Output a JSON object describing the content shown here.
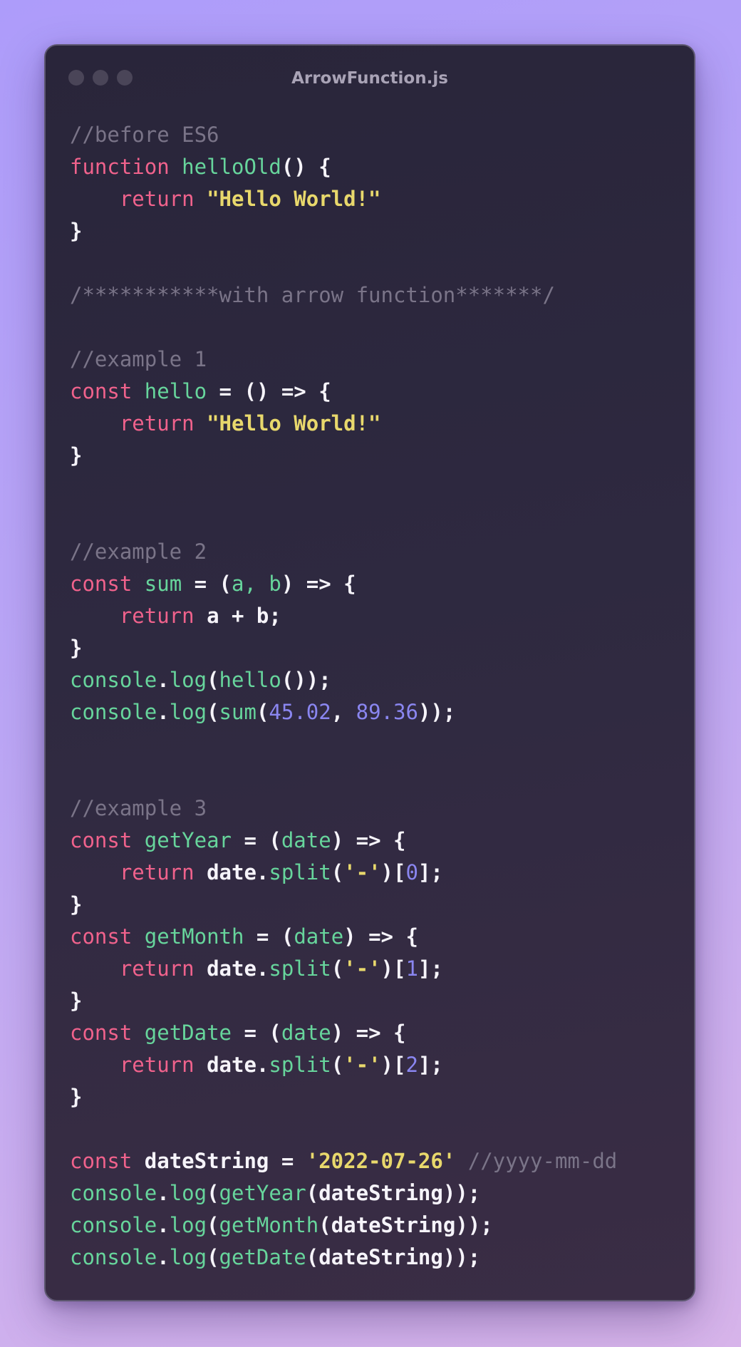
{
  "window": {
    "title": "ArrowFunction.js"
  },
  "colors": {
    "keyword": "#f0628c",
    "function": "#67d59c",
    "string": "#e8d86c",
    "comment": "#7a7488",
    "number": "#8a86f0",
    "plain": "#f6f4fa"
  },
  "code": {
    "lines": [
      [
        [
          "cmt",
          "//before ES6"
        ]
      ],
      [
        [
          "kw",
          "function"
        ],
        [
          "id",
          " "
        ],
        [
          "fn",
          "helloOld"
        ],
        [
          "punc",
          "() {"
        ]
      ],
      [
        [
          "id",
          "    "
        ],
        [
          "kw",
          "return"
        ],
        [
          "id",
          " "
        ],
        [
          "str",
          "\"Hello World!\""
        ]
      ],
      [
        [
          "punc",
          "}"
        ]
      ],
      [],
      [
        [
          "cmt",
          "/***********with arrow function*******/"
        ]
      ],
      [],
      [
        [
          "cmt",
          "//example 1"
        ]
      ],
      [
        [
          "kw",
          "const"
        ],
        [
          "id",
          " "
        ],
        [
          "fn",
          "hello"
        ],
        [
          "punc",
          " = () => {"
        ]
      ],
      [
        [
          "id",
          "    "
        ],
        [
          "kw",
          "return"
        ],
        [
          "id",
          " "
        ],
        [
          "str",
          "\"Hello World!\""
        ]
      ],
      [
        [
          "punc",
          "}"
        ]
      ],
      [],
      [],
      [
        [
          "cmt",
          "//example 2"
        ]
      ],
      [
        [
          "kw",
          "const"
        ],
        [
          "id",
          " "
        ],
        [
          "fn",
          "sum"
        ],
        [
          "punc",
          " = ("
        ],
        [
          "fn",
          "a, b"
        ],
        [
          "punc",
          ") => {"
        ]
      ],
      [
        [
          "id",
          "    "
        ],
        [
          "kw",
          "return"
        ],
        [
          "id",
          " a + b;"
        ]
      ],
      [
        [
          "punc",
          "}"
        ]
      ],
      [
        [
          "fn",
          "console"
        ],
        [
          "punc",
          "."
        ],
        [
          "fn",
          "log"
        ],
        [
          "punc",
          "("
        ],
        [
          "fn",
          "hello"
        ],
        [
          "punc",
          "());"
        ]
      ],
      [
        [
          "fn",
          "console"
        ],
        [
          "punc",
          "."
        ],
        [
          "fn",
          "log"
        ],
        [
          "punc",
          "("
        ],
        [
          "fn",
          "sum"
        ],
        [
          "punc",
          "("
        ],
        [
          "num",
          "45.02"
        ],
        [
          "punc",
          ", "
        ],
        [
          "num",
          "89.36"
        ],
        [
          "punc",
          "));"
        ]
      ],
      [],
      [],
      [
        [
          "cmt",
          "//example 3"
        ]
      ],
      [
        [
          "kw",
          "const"
        ],
        [
          "id",
          " "
        ],
        [
          "fn",
          "getYear"
        ],
        [
          "punc",
          " = ("
        ],
        [
          "fn",
          "date"
        ],
        [
          "punc",
          ") => {"
        ]
      ],
      [
        [
          "id",
          "    "
        ],
        [
          "kw",
          "return"
        ],
        [
          "id",
          " date."
        ],
        [
          "fn",
          "split"
        ],
        [
          "punc",
          "("
        ],
        [
          "str",
          "'-'"
        ],
        [
          "punc",
          ")["
        ],
        [
          "num",
          "0"
        ],
        [
          "punc",
          "];"
        ]
      ],
      [
        [
          "punc",
          "}"
        ]
      ],
      [
        [
          "kw",
          "const"
        ],
        [
          "id",
          " "
        ],
        [
          "fn",
          "getMonth"
        ],
        [
          "punc",
          " = ("
        ],
        [
          "fn",
          "date"
        ],
        [
          "punc",
          ") => {"
        ]
      ],
      [
        [
          "id",
          "    "
        ],
        [
          "kw",
          "return"
        ],
        [
          "id",
          " date."
        ],
        [
          "fn",
          "split"
        ],
        [
          "punc",
          "("
        ],
        [
          "str",
          "'-'"
        ],
        [
          "punc",
          ")["
        ],
        [
          "num",
          "1"
        ],
        [
          "punc",
          "];"
        ]
      ],
      [
        [
          "punc",
          "}"
        ]
      ],
      [
        [
          "kw",
          "const"
        ],
        [
          "id",
          " "
        ],
        [
          "fn",
          "getDate"
        ],
        [
          "punc",
          " = ("
        ],
        [
          "fn",
          "date"
        ],
        [
          "punc",
          ") => {"
        ]
      ],
      [
        [
          "id",
          "    "
        ],
        [
          "kw",
          "return"
        ],
        [
          "id",
          " date."
        ],
        [
          "fn",
          "split"
        ],
        [
          "punc",
          "("
        ],
        [
          "str",
          "'-'"
        ],
        [
          "punc",
          ")["
        ],
        [
          "num",
          "2"
        ],
        [
          "punc",
          "];"
        ]
      ],
      [
        [
          "punc",
          "}"
        ]
      ],
      [],
      [
        [
          "kw",
          "const"
        ],
        [
          "id",
          " dateString = "
        ],
        [
          "str",
          "'2022-07-26'"
        ],
        [
          "id",
          " "
        ],
        [
          "cmt",
          "//yyyy-mm-dd"
        ]
      ],
      [
        [
          "fn",
          "console"
        ],
        [
          "punc",
          "."
        ],
        [
          "fn",
          "log"
        ],
        [
          "punc",
          "("
        ],
        [
          "fn",
          "getYear"
        ],
        [
          "punc",
          "("
        ],
        [
          "id",
          "dateString"
        ],
        [
          "punc",
          "));"
        ]
      ],
      [
        [
          "fn",
          "console"
        ],
        [
          "punc",
          "."
        ],
        [
          "fn",
          "log"
        ],
        [
          "punc",
          "("
        ],
        [
          "fn",
          "getMonth"
        ],
        [
          "punc",
          "("
        ],
        [
          "id",
          "dateString"
        ],
        [
          "punc",
          "));"
        ]
      ],
      [
        [
          "fn",
          "console"
        ],
        [
          "punc",
          "."
        ],
        [
          "fn",
          "log"
        ],
        [
          "punc",
          "("
        ],
        [
          "fn",
          "getDate"
        ],
        [
          "punc",
          "("
        ],
        [
          "id",
          "dateString"
        ],
        [
          "punc",
          "));"
        ]
      ]
    ]
  }
}
